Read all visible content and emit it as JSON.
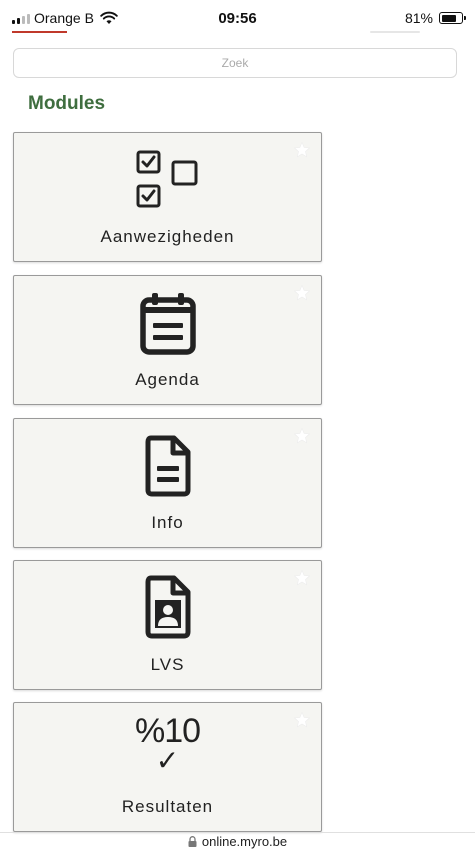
{
  "status_bar": {
    "carrier": "Orange B",
    "time": "09:56",
    "battery": "81%",
    "battery_level": 0.81
  },
  "search": {
    "placeholder": "Zoek"
  },
  "section": {
    "title": "Modules"
  },
  "modules": [
    {
      "label": "Aanwezigheden",
      "icon": "checklist-icon"
    },
    {
      "label": "Agenda",
      "icon": "calendar-icon"
    },
    {
      "label": "Info",
      "icon": "document-icon"
    },
    {
      "label": "LVS",
      "icon": "student-file-icon"
    },
    {
      "label": "Resultaten",
      "icon": "grade-icon",
      "icon_text": "%10",
      "icon_mark": "✓"
    }
  ],
  "url_bar": {
    "url": "online.myro.be"
  },
  "colors": {
    "accent_green": "#3f6e3f",
    "tile_background": "#f5f5f2",
    "tile_border": "#9a9a9a",
    "carrier_underline": "#c0392b"
  }
}
